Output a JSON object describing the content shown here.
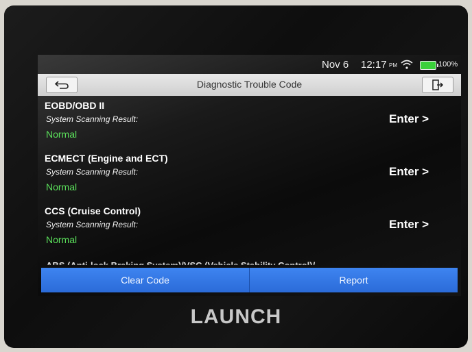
{
  "status": {
    "date": "Nov 6",
    "time": "12:17",
    "ampm": "PM",
    "battery": "100%",
    "battery_color": "#3ad13a"
  },
  "header": {
    "title": "Diagnostic Trouble Code",
    "back_icon": "back-arrow-icon",
    "exit_icon": "exit-icon"
  },
  "systems": [
    {
      "name": "EOBD/OBD II",
      "subtitle": "System Scanning Result:",
      "status": "Normal",
      "action": "Enter >"
    },
    {
      "name": "ECMECT (Engine and ECT)",
      "subtitle": "System Scanning Result:",
      "status": "Normal",
      "action": "Enter >"
    },
    {
      "name": "CCS (Cruise Control)",
      "subtitle": "System Scanning Result:",
      "status": "Normal",
      "action": "Enter >"
    }
  ],
  "partial_item": "ABS (Anti-lock Braking System)/VSC (Vehicle Stability Control)/",
  "footer": {
    "clear_label": "Clear Code",
    "report_label": "Report",
    "button_color": "#3478e6"
  },
  "device": {
    "brand": "LAUNCH"
  },
  "colors": {
    "normal_status": "#5be05b"
  }
}
